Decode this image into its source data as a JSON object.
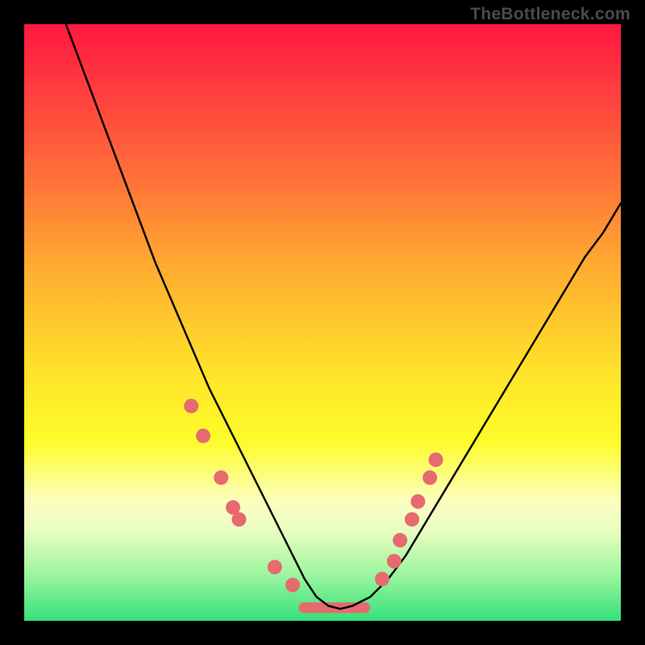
{
  "watermark": "TheBottleneck.com",
  "chart_data": {
    "type": "line",
    "title": "",
    "xlabel": "",
    "ylabel": "",
    "xlim": [
      0,
      100
    ],
    "ylim": [
      0,
      100
    ],
    "series": [
      {
        "name": "curve",
        "x": [
          7,
          10,
          13,
          16,
          19,
          22,
          25,
          28,
          31,
          34,
          37,
          40,
          43,
          45,
          47,
          49,
          51,
          53,
          55,
          58,
          61,
          64,
          67,
          70,
          73,
          76,
          79,
          82,
          85,
          88,
          91,
          94,
          97,
          100
        ],
        "y": [
          100,
          92,
          84,
          76,
          68,
          60,
          53,
          46,
          39,
          33,
          27,
          21,
          15,
          11,
          7,
          4,
          2.5,
          2,
          2.5,
          4,
          7,
          11,
          16,
          21,
          26,
          31,
          36,
          41,
          46,
          51,
          56,
          61,
          65,
          70
        ]
      }
    ],
    "markers": {
      "name": "highlight-dots",
      "color": "#e66a6f",
      "points": [
        {
          "x": 28,
          "y": 36
        },
        {
          "x": 30,
          "y": 31
        },
        {
          "x": 33,
          "y": 24
        },
        {
          "x": 35,
          "y": 19
        },
        {
          "x": 36,
          "y": 17
        },
        {
          "x": 42,
          "y": 9
        },
        {
          "x": 45,
          "y": 6
        },
        {
          "x": 60,
          "y": 7
        },
        {
          "x": 62,
          "y": 10
        },
        {
          "x": 63,
          "y": 13.5
        },
        {
          "x": 65,
          "y": 17
        },
        {
          "x": 66,
          "y": 20
        },
        {
          "x": 68,
          "y": 24
        },
        {
          "x": 69,
          "y": 27
        }
      ]
    },
    "plateau": {
      "name": "bottom-band",
      "color": "#e66a6f",
      "x_start": 46,
      "x_end": 58,
      "y": 2.2,
      "height": 1.8
    }
  },
  "palette": {
    "curve_stroke": "#000000",
    "marker_fill": "#e66a6f",
    "plateau_fill": "#e66a6f"
  }
}
